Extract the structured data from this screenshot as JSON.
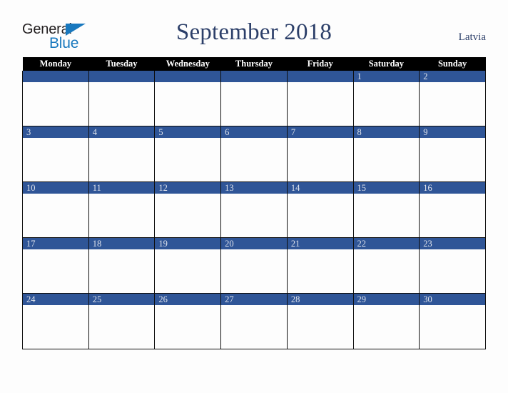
{
  "brand": {
    "name_part1": "General",
    "name_part2": "Blue",
    "triangle_color": "#1878be"
  },
  "header": {
    "title": "September 2018",
    "locale": "Latvia",
    "title_color": "#2c3f69"
  },
  "calendar": {
    "weekday_headers": [
      "Monday",
      "Tuesday",
      "Wednesday",
      "Thursday",
      "Friday",
      "Saturday",
      "Sunday"
    ],
    "header_bg": "#000000",
    "daynum_bg": "#2f5597",
    "daynum_color": "#dfe3ec",
    "weeks": [
      [
        {
          "day": "",
          "blank": true
        },
        {
          "day": "",
          "blank": true
        },
        {
          "day": "",
          "blank": true
        },
        {
          "day": "",
          "blank": true
        },
        {
          "day": "",
          "blank": true
        },
        {
          "day": "1",
          "blank": false
        },
        {
          "day": "2",
          "blank": false
        }
      ],
      [
        {
          "day": "3",
          "blank": false
        },
        {
          "day": "4",
          "blank": false
        },
        {
          "day": "5",
          "blank": false
        },
        {
          "day": "6",
          "blank": false
        },
        {
          "day": "7",
          "blank": false
        },
        {
          "day": "8",
          "blank": false
        },
        {
          "day": "9",
          "blank": false
        }
      ],
      [
        {
          "day": "10",
          "blank": false
        },
        {
          "day": "11",
          "blank": false
        },
        {
          "day": "12",
          "blank": false
        },
        {
          "day": "13",
          "blank": false
        },
        {
          "day": "14",
          "blank": false
        },
        {
          "day": "15",
          "blank": false
        },
        {
          "day": "16",
          "blank": false
        }
      ],
      [
        {
          "day": "17",
          "blank": false
        },
        {
          "day": "18",
          "blank": false
        },
        {
          "day": "19",
          "blank": false
        },
        {
          "day": "20",
          "blank": false
        },
        {
          "day": "21",
          "blank": false
        },
        {
          "day": "22",
          "blank": false
        },
        {
          "day": "23",
          "blank": false
        }
      ],
      [
        {
          "day": "24",
          "blank": false
        },
        {
          "day": "25",
          "blank": false
        },
        {
          "day": "26",
          "blank": false
        },
        {
          "day": "27",
          "blank": false
        },
        {
          "day": "28",
          "blank": false
        },
        {
          "day": "29",
          "blank": false
        },
        {
          "day": "30",
          "blank": false
        }
      ]
    ]
  }
}
